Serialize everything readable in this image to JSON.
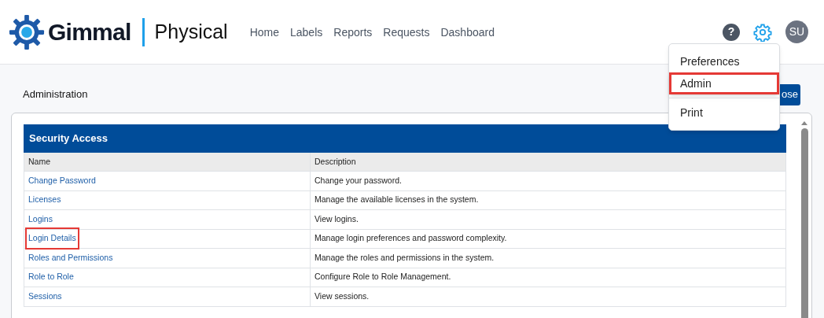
{
  "header": {
    "logo_text": "Gimmal",
    "product": "Physical",
    "nav": [
      {
        "label": "Home"
      },
      {
        "label": "Labels"
      },
      {
        "label": "Reports"
      },
      {
        "label": "Requests"
      },
      {
        "label": "Dashboard"
      }
    ],
    "help": "?",
    "avatar": "SU"
  },
  "settings_menu": {
    "items": [
      {
        "label": "Preferences",
        "highlighted": false,
        "divider_before": false
      },
      {
        "label": "Admin",
        "highlighted": true,
        "divider_before": false
      },
      {
        "label": "Print",
        "highlighted": false,
        "divider_before": true
      }
    ]
  },
  "page": {
    "title": "Administration",
    "close_button": "ose"
  },
  "section": {
    "title": "Security Access",
    "columns": [
      "Name",
      "Description"
    ],
    "rows": [
      {
        "name": "Change Password",
        "description": "Change your password.",
        "highlighted": false
      },
      {
        "name": "Licenses",
        "description": "Manage the available licenses in the system.",
        "highlighted": false
      },
      {
        "name": "Logins",
        "description": "View logins.",
        "highlighted": false
      },
      {
        "name": "Login Details",
        "description": "Manage login preferences and password complexity.",
        "highlighted": true
      },
      {
        "name": "Roles and Permissions",
        "description": "Manage the roles and permissions in the system.",
        "highlighted": false
      },
      {
        "name": "Role to Role",
        "description": "Configure Role to Role Management.",
        "highlighted": false
      },
      {
        "name": "Sessions",
        "description": "View sessions.",
        "highlighted": false
      }
    ]
  }
}
